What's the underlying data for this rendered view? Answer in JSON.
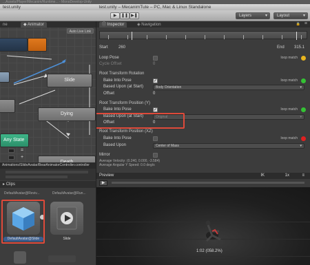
{
  "window": {
    "top_strip": "...Assets/Player/Mecanim/Runtime... - MonoDevelop-Unity",
    "title_left": "test.unity",
    "title": "test.unity – MecanimTute – PC, Mac & Linux Standalone",
    "play_glyph": "▶",
    "pause_glyph": "❚❚",
    "step_glyph": "▶❚",
    "layers": "Layers",
    "layout": "Layout",
    "chevron": "▾"
  },
  "animator": {
    "tab_scene": "ne",
    "tab_animator": "Animator",
    "live_link": "Auto Live Link",
    "nodes": {
      "slide": "Slide",
      "dying": "Dying",
      "any_state": "Any State",
      "death": "Death"
    },
    "param_symbols": [
      "=",
      "+",
      "−"
    ],
    "footer": "Animations/SlideAvatar/BearAnimatorController.controller"
  },
  "inspector": {
    "tab_inspector": "Inspector",
    "tab_navigation": "Navigation",
    "lock_glyph": "🔒",
    "menu_glyph": "≡",
    "start_label": "Start",
    "start_value": "260",
    "end_label": "End",
    "end_value": "315.1",
    "loop_pose": "Loop Pose",
    "cycle_offset": "Cycle Offset",
    "cycle_offset_value": "0",
    "loop_match": "loop match",
    "rotation_header": "Root Transform Rotation",
    "bake_into_pose": "Bake Into Pose",
    "based_upon_start": "Based Upon (at Start)",
    "body_orientation": "Body Orientation",
    "offset": "Offset",
    "offset_value": "0",
    "pos_y_header": "Root Transform Position (Y)",
    "original": "Original",
    "pos_xz_header": "Root Transform Position (XZ)",
    "based_upon": "Based Upon",
    "center_of_mass": "Center of Mass",
    "mirror": "Mirror",
    "avg_velocity": "Average Velocity: (0.240, 0.000, -3.584)",
    "avg_angular": "Average Angular Y Speed: 0.0 deg/s",
    "check_glyph": "✓",
    "dot_colors": {
      "yellow": "#e8b51e",
      "green": "#34c234",
      "red": "#e02020"
    }
  },
  "project": {
    "tab": "Clips",
    "row_labels": [
      "DefaultAvatar@Reviv...",
      "DefaultAvatar@Run..."
    ],
    "assets": [
      {
        "label": "DefaultAvatar@Slide",
        "selected": true
      },
      {
        "label": "Slide",
        "selected": false
      }
    ]
  },
  "preview": {
    "title": "Preview",
    "ik": "IK",
    "speed": "1x",
    "play_glyph": "▶",
    "time": "1:02 (058.2%)"
  },
  "highlight_color": "#e04a3a"
}
